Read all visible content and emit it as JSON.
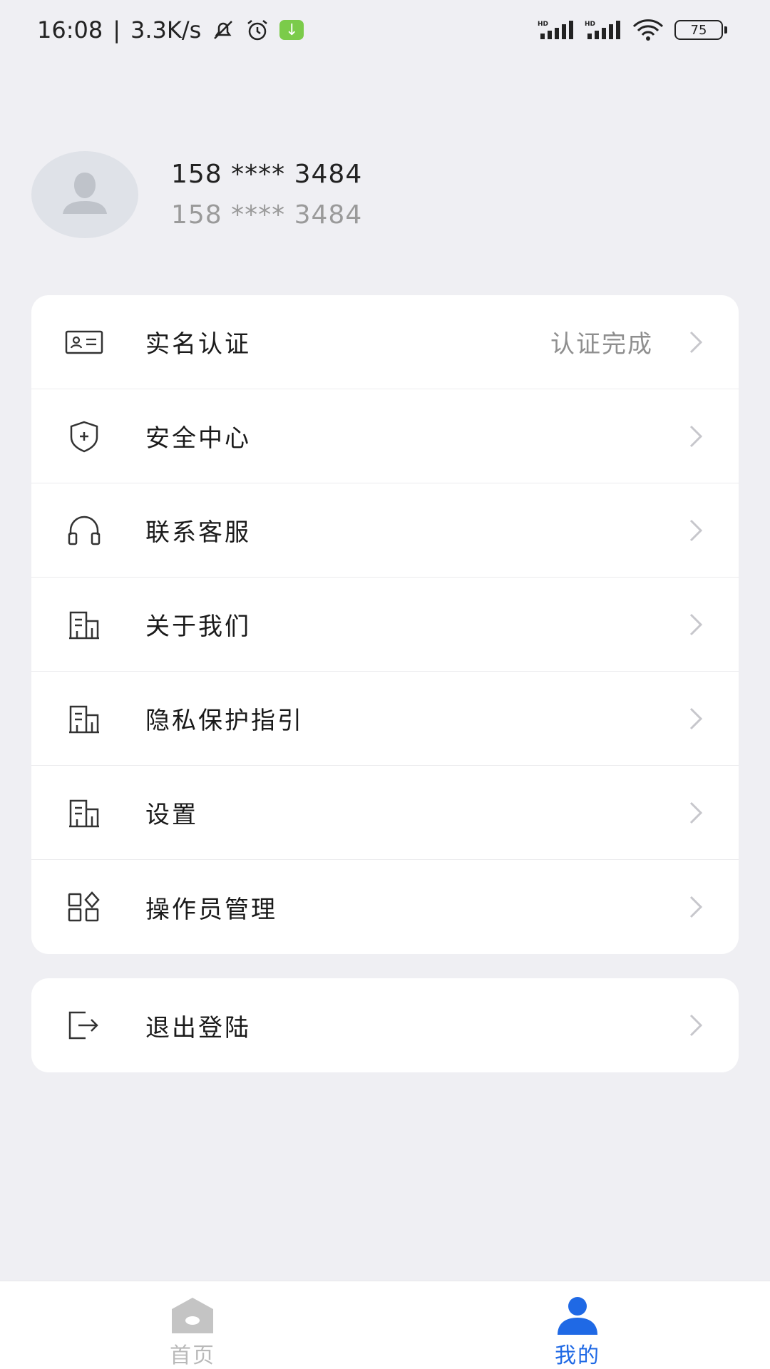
{
  "status_bar": {
    "time": "16:08",
    "separator": "|",
    "speed": "3.3K/s",
    "battery": "75",
    "icons": [
      "mute-icon",
      "alarm-icon",
      "download-icon",
      "hd-signal-icon",
      "hd-signal-icon",
      "wifi-icon",
      "battery-icon"
    ]
  },
  "profile": {
    "phone": "158 **** 3484",
    "phone_secondary": "158 **** 3484",
    "avatar_icon": "user-placeholder-icon"
  },
  "menu": {
    "items": [
      {
        "label": "实名认证",
        "value": "认证完成",
        "icon": "id-card-icon"
      },
      {
        "label": "安全中心",
        "value": "",
        "icon": "shield-icon"
      },
      {
        "label": "联系客服",
        "value": "",
        "icon": "headset-icon"
      },
      {
        "label": "关于我们",
        "value": "",
        "icon": "building-icon"
      },
      {
        "label": "隐私保护指引",
        "value": "",
        "icon": "building-icon"
      },
      {
        "label": "设置",
        "value": "",
        "icon": "building-icon"
      },
      {
        "label": "操作员管理",
        "value": "",
        "icon": "apps-icon"
      }
    ]
  },
  "logout": {
    "label": "退出登陆",
    "icon": "logout-icon"
  },
  "bottom_nav": {
    "items": [
      {
        "label": "首页",
        "icon": "home-icon",
        "active": false
      },
      {
        "label": "我的",
        "icon": "user-icon",
        "active": true
      }
    ],
    "active_color": "#1f69e5",
    "inactive_color": "#b9b9b9"
  },
  "colors": {
    "background": "#efeff3",
    "card": "#ffffff",
    "accent": "#1f69e5",
    "download_badge": "#7bcb4a"
  }
}
